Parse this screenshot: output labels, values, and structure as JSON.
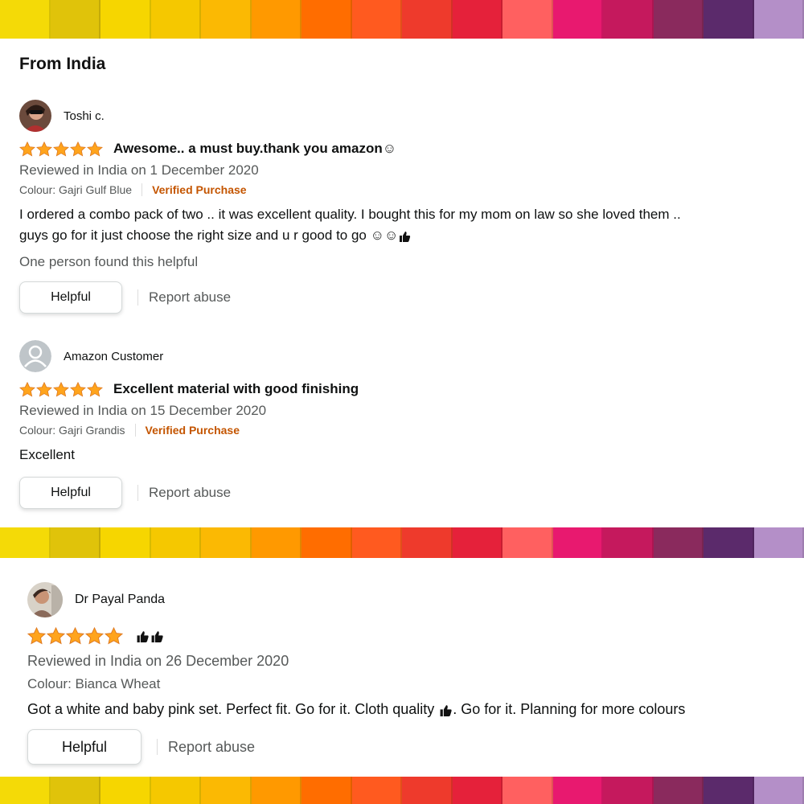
{
  "stripe_colors": [
    "#f4da07",
    "#e0c30a",
    "#f6d600",
    "#f5c800",
    "#fbb903",
    "#ff9900",
    "#ff6d00",
    "#ff5a1f",
    "#ee3a2c",
    "#e5213a",
    "#ff6060",
    "#e8196f",
    "#c5195d",
    "#8a2a5d",
    "#5b2a6b",
    "#b48fc8"
  ],
  "section": {
    "title": "From India"
  },
  "reviews": [
    {
      "author": "Toshi c.",
      "avatar_icon": "user-photo-avatar",
      "rating": 5,
      "title": "Awesome.. a must buy.thank you amazon☺",
      "date": "Reviewed in India on 1 December 2020",
      "colour": "Colour: Gajri Gulf Blue",
      "verified": "Verified Purchase",
      "body_line1": "I ordered a combo pack of two .. it was excellent quality. I bought this for my mom on law so she loved them ..",
      "body_line2": "guys go for it just choose the right size and u r good to go ☺☺",
      "helpful_count": "One person found this helpful",
      "helpful_label": "Helpful",
      "report_label": "Report abuse"
    },
    {
      "author": "Amazon Customer",
      "avatar_icon": "default-user-avatar",
      "rating": 5,
      "title": "Excellent material with good finishing",
      "date": "Reviewed in India on 15 December 2020",
      "colour": "Colour: Gajri Grandis",
      "verified": "Verified Purchase",
      "body": "Excellent",
      "helpful_label": "Helpful",
      "report_label": "Report abuse"
    },
    {
      "author": "Dr Payal Panda",
      "avatar_icon": "user-photo-avatar",
      "rating": 5,
      "title_icon": "thumbs-up-emoji",
      "date": "Reviewed in India on 26 December 2020",
      "colour": "Colour: Bianca Wheat",
      "body_part1": "Got a white and baby pink set. Perfect fit. Go for it. Cloth quality ",
      "body_part2": ". Go for it. Planning for more colours",
      "helpful_label": "Helpful",
      "report_label": "Report abuse"
    }
  ],
  "colors": {
    "star": "#ffa41c",
    "verified": "#c45500",
    "secondary_text": "#565959"
  }
}
